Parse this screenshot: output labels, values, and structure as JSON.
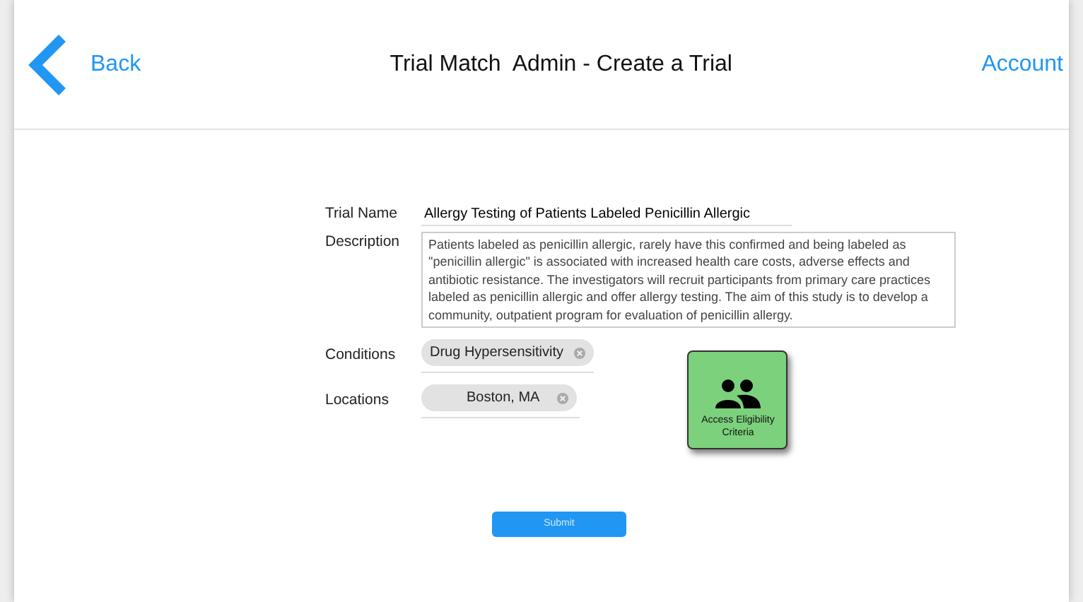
{
  "header": {
    "back": "Back",
    "title": "Trial Match  Admin - Create a Trial",
    "account": "Account"
  },
  "form": {
    "trial_name_label": "Trial Name",
    "trial_name": "Allergy Testing of Patients Labeled Penicillin Allergic",
    "description_label": "Description",
    "description": "Patients labeled as penicillin allergic, rarely have this confirmed and being labeled as \"penicillin allergic\" is associated with increased health care costs, adverse effects and antibiotic resistance. The investigators will recruit participants from primary care practices labeled as penicillin allergic and offer allergy testing. The aim of this study is to develop a community, outpatient program for evaluation of penicillin allergy.",
    "conditions_label": "Conditions",
    "conditions": [
      "Drug Hypersensitivity"
    ],
    "locations_label": "Locations",
    "locations": [
      "Boston, MA"
    ]
  },
  "tile": {
    "label": "Access Eligibility Criteria"
  },
  "submit": "Submit"
}
